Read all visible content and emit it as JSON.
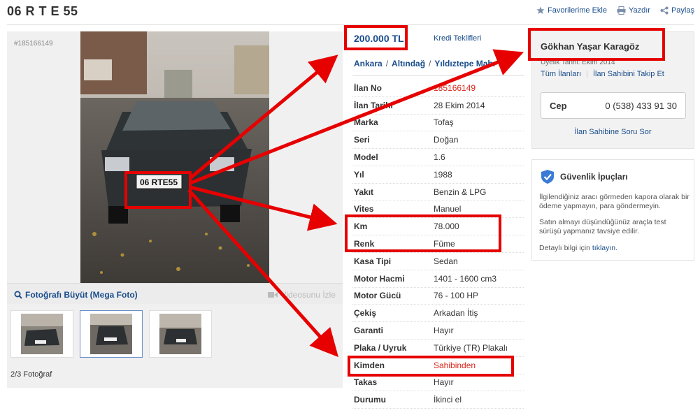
{
  "header": {
    "title": "06 R T E 55",
    "favorite_label": "Favorilerime Ekle",
    "print_label": "Yazdır",
    "share_label": "Paylaş"
  },
  "gallery": {
    "listing_number": "#185166149",
    "mega_photo_label": "Fotoğrafı Büyüt (Mega Foto)",
    "video_label": "Videosunu İzle",
    "photo_count": "2/3 Fotoğraf",
    "plate_text": "06 RTE55"
  },
  "listing": {
    "price": "200.000 TL",
    "credit_link": "Kredi Teklifleri",
    "breadcrumb": [
      "Ankara",
      "Altındağ",
      "Yıldıztepe Mah."
    ],
    "rows": [
      {
        "key": "İlan No",
        "value": "185166149",
        "red": true
      },
      {
        "key": "İlan Tarihi",
        "value": "28 Ekim 2014"
      },
      {
        "key": "Marka",
        "value": "Tofaş"
      },
      {
        "key": "Seri",
        "value": "Doğan"
      },
      {
        "key": "Model",
        "value": "1.6"
      },
      {
        "key": "Yıl",
        "value": "1988"
      },
      {
        "key": "Yakıt",
        "value": "Benzin & LPG"
      },
      {
        "key": "Vites",
        "value": "Manuel"
      },
      {
        "key": "Km",
        "value": "78.000"
      },
      {
        "key": "Renk",
        "value": "Füme"
      },
      {
        "key": "Kasa Tipi",
        "value": "Sedan"
      },
      {
        "key": "Motor Hacmi",
        "value": "1401 - 1600 cm3"
      },
      {
        "key": "Motor Gücü",
        "value": "76 - 100 HP"
      },
      {
        "key": "Çekiş",
        "value": "Arkadan İtiş"
      },
      {
        "key": "Garanti",
        "value": "Hayır"
      },
      {
        "key": "Plaka / Uyruk",
        "value": "Türkiye (TR) Plakalı"
      },
      {
        "key": "Kimden",
        "value": "Sahibinden",
        "red": true
      },
      {
        "key": "Takas",
        "value": "Hayır"
      },
      {
        "key": "Durumu",
        "value": "İkinci el"
      }
    ]
  },
  "seller": {
    "name": "Gökhan Yaşar Karagöz",
    "member_since": "Üyelik Tarihi: Ekim 2014",
    "all_listings": "Tüm İlanları",
    "follow": "İlan Sahibini Takip Et",
    "phone_label": "Cep",
    "phone_number": "0 (538) 433 91 30",
    "ask_question": "İlan Sahibine Soru Sor"
  },
  "safety": {
    "title": "Güvenlik İpuçları",
    "p1": "İlgilendiğiniz aracı görmeden kapora olarak bir ödeme yapmayın, para göndermeyin.",
    "p2": "Satın almayı düşündüğünüz araçla test sürüşü yapmanız tavsiye edilir.",
    "p3_prefix": "Detaylı bilgi için ",
    "p3_link": "tıklayın",
    "p3_suffix": "."
  },
  "colors": {
    "link": "#1a4d8c",
    "highlight": "#e60000",
    "red_text": "#d9261c"
  }
}
